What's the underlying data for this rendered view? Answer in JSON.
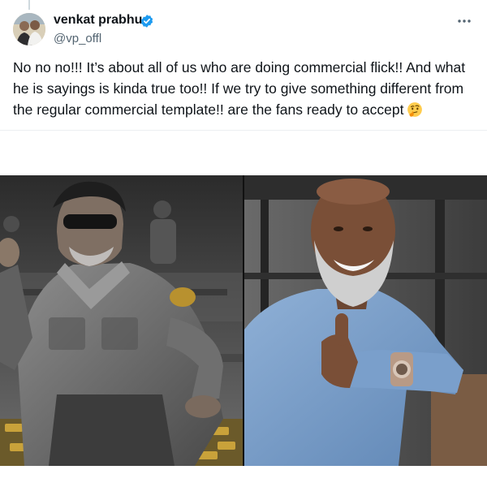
{
  "tweet": {
    "author_name": "venkat prabhu",
    "handle": "@vp_offl",
    "text": "No no no!!! It’s about all of us who are doing commercial flick!! And what he is sayings is kinda true too!! If we try to give something different from the regular commercial template!! are the fans ready to accept",
    "emoji": "thinking-face",
    "verified": true
  },
  "icons": {
    "verified": "verified-badge-icon",
    "more": "more-options-icon",
    "emoji": "thinking-face-icon"
  },
  "colors": {
    "text": "#0f1419",
    "secondary": "#536471",
    "verified": "#1d9bf0"
  },
  "media": {
    "left_photo": "grayscale photo of a man in sunglasses and a shirt seated among gold",
    "right_photo": "photo of a smiling bald man with a grey beard giving a thumbs up"
  }
}
